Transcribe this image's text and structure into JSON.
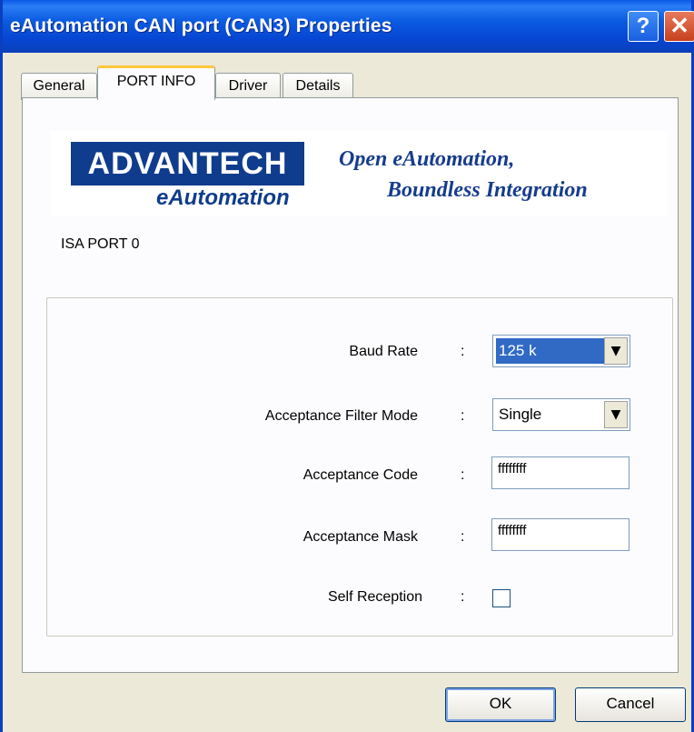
{
  "window": {
    "title": "eAutomation CAN port (CAN3) Properties",
    "help_label": "?",
    "close_label": "✕"
  },
  "tabs": [
    {
      "label": "General",
      "active": false
    },
    {
      "label": "PORT INFO",
      "active": true
    },
    {
      "label": "Driver",
      "active": false
    },
    {
      "label": "Details",
      "active": false
    }
  ],
  "banner": {
    "logo_text": "ADVANTECH",
    "logo_subtext": "eAutomation",
    "slogan_line1": "Open eAutomation,",
    "slogan_line2": "Boundless Integration"
  },
  "port_name": "ISA PORT 0",
  "settings": {
    "baud_rate": {
      "label": "Baud Rate",
      "value": "125 k"
    },
    "filter_mode": {
      "label": "Acceptance Filter Mode",
      "value": "Single"
    },
    "acceptance_code": {
      "label": "Acceptance Code",
      "value": "ffffffff"
    },
    "acceptance_mask": {
      "label": "Acceptance Mask",
      "value": "ffffffff"
    },
    "self_reception": {
      "label": "Self Reception",
      "checked": false
    },
    "separator": ":"
  },
  "buttons": {
    "ok": "OK",
    "cancel": "Cancel"
  },
  "colors": {
    "titlebar": "#0646d2",
    "dialog_bg": "#ece9d8",
    "brand_blue": "#0f3c8c",
    "selection": "#316ac5",
    "active_tab_highlight": "#ffc83c"
  }
}
